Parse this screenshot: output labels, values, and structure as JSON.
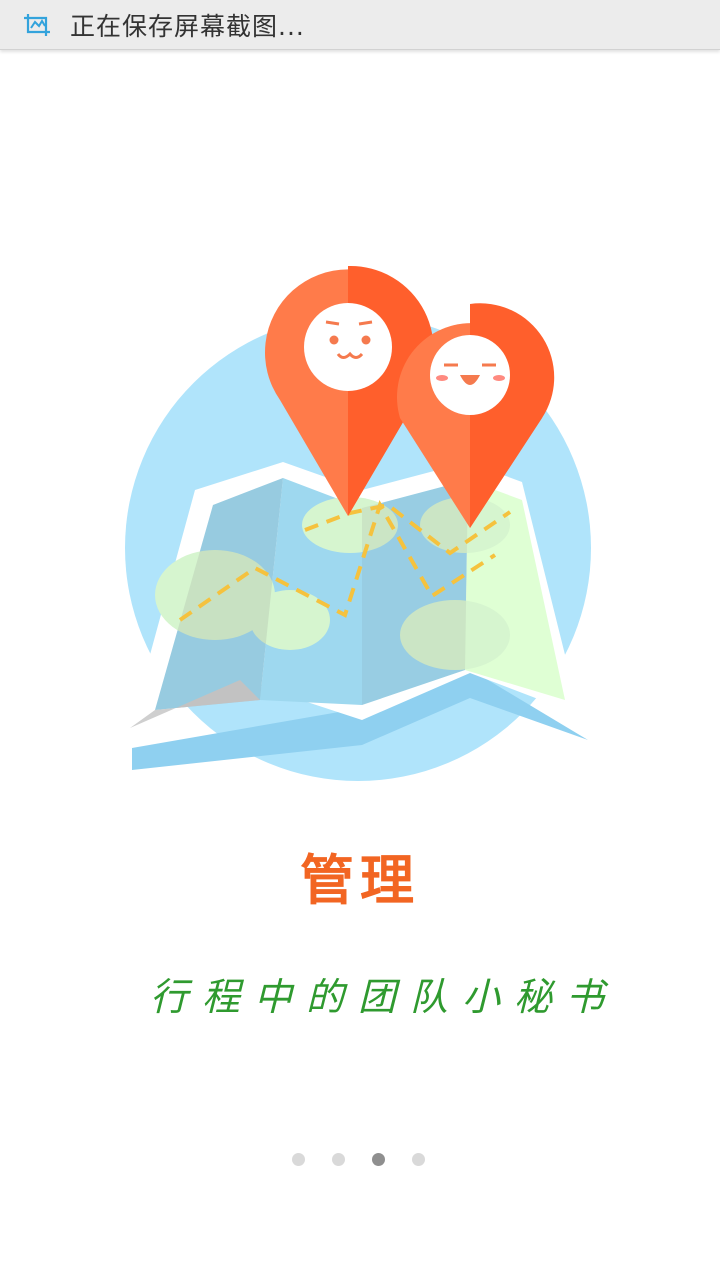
{
  "notification": {
    "text": "正在保存屏幕截图...",
    "icon": "screenshot-icon"
  },
  "onboarding": {
    "title": "管理",
    "subtitle": "行程中的团队小秘书",
    "illustration": "map-with-location-pins",
    "page_count": 4,
    "active_page": 3
  },
  "colors": {
    "title": "#f26522",
    "subtitle": "#2f9a2f",
    "pin": "#ff6633",
    "circle": "#b0e4fb"
  }
}
